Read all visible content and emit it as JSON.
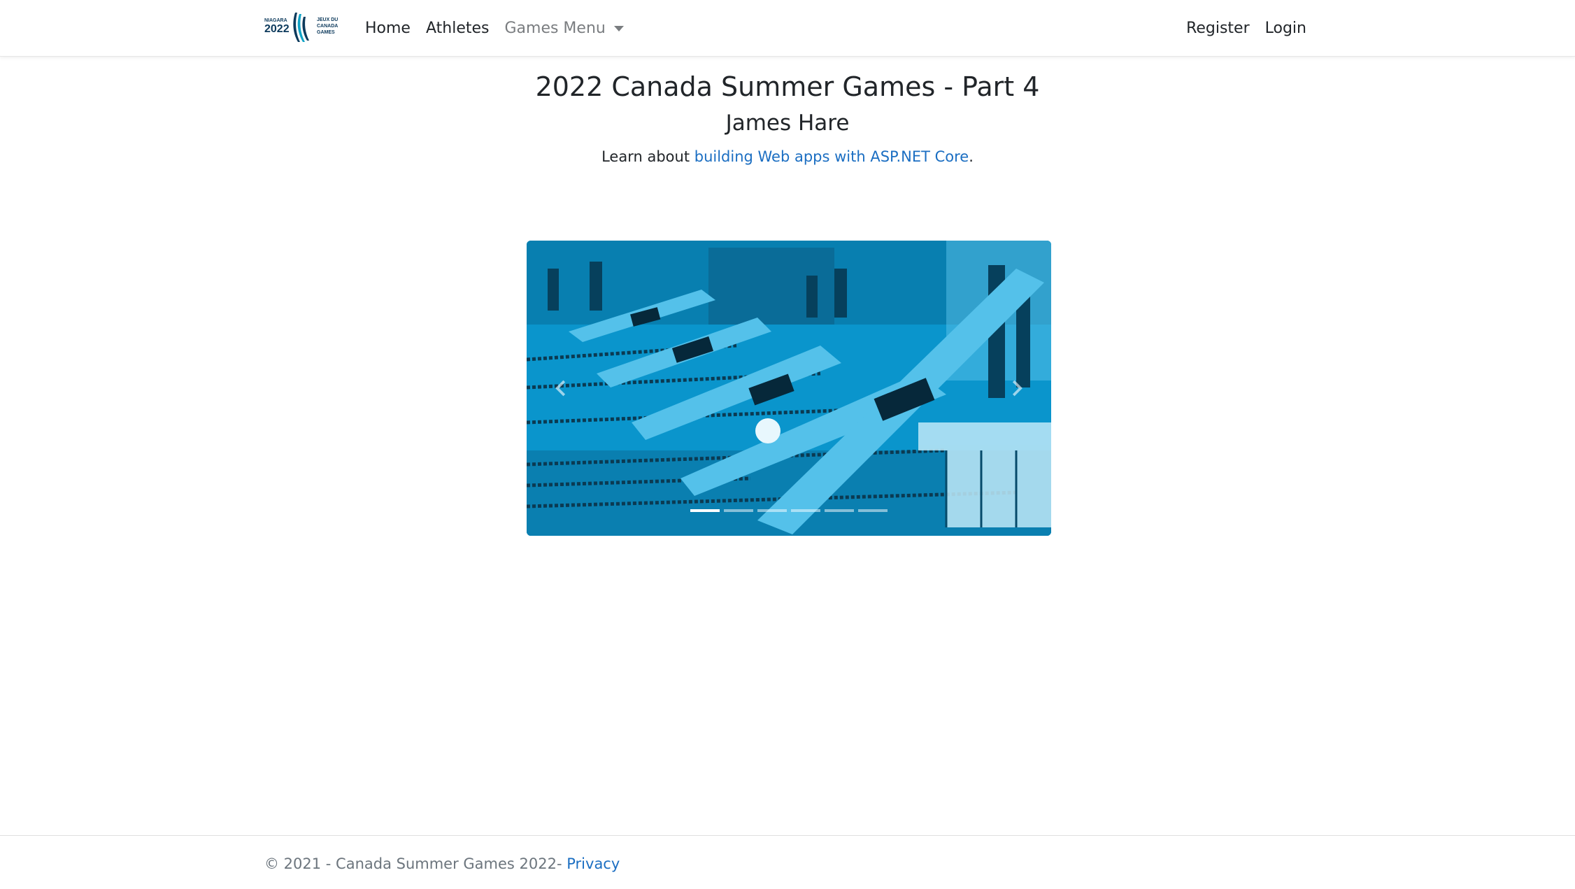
{
  "navbar": {
    "brand": {
      "top_word": "NIAGARA",
      "year": "2022",
      "right_words": [
        "JEUX DU",
        "CANADA",
        "GAMES"
      ]
    },
    "left_links": [
      {
        "label": "Home"
      },
      {
        "label": "Athletes"
      },
      {
        "label": "Games Menu"
      }
    ],
    "right_links": [
      {
        "label": "Register"
      },
      {
        "label": "Login"
      }
    ]
  },
  "main": {
    "title": "2022 Canada Summer Games - Part 4",
    "subtitle": "James Hare",
    "intro_prefix": "Learn about ",
    "intro_link": "building Web apps with ASP.NET Core",
    "intro_suffix": "."
  },
  "carousel": {
    "slide_count": 6,
    "active_index": 0,
    "tint_color": "#0a95cc",
    "prev_icon": "chevron-left-icon",
    "next_icon": "chevron-right-icon"
  },
  "footer": {
    "text": "© 2021 - Canada Summer Games 2022- ",
    "link": "Privacy"
  },
  "colors": {
    "link": "#1b6ec2",
    "text": "#212529",
    "muted": "#6c757d",
    "brand_dark": "#0d3a5c",
    "brand_teal": "#11a3c6"
  }
}
